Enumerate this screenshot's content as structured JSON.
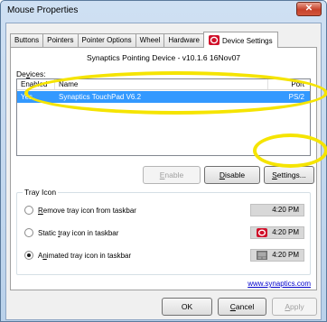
{
  "window": {
    "title": "Mouse Properties",
    "close_label": "✕"
  },
  "tabs": [
    "Buttons",
    "Pointers",
    "Pointer Options",
    "Wheel",
    "Hardware",
    "Device Settings"
  ],
  "driver": {
    "title": "Synaptics Pointing Device - v10.1.6 16Nov07"
  },
  "devices": {
    "label_prefix": "De",
    "label_underlined": "v",
    "label_suffix": "ices:",
    "columns": [
      "Enabled",
      "Name",
      "Port"
    ],
    "rows": [
      {
        "enabled": "Yes",
        "name": "Synaptics TouchPad V6.2",
        "port": "PS/2"
      }
    ]
  },
  "device_buttons": {
    "enable": {
      "u": "E",
      "rest": "nable"
    },
    "disable": {
      "u": "D",
      "rest": "isable"
    },
    "settings": {
      "u": "S",
      "rest": "ettings..."
    }
  },
  "tray": {
    "legend": "Tray Icon",
    "options": [
      {
        "u": "R",
        "rest": "emove tray icon from taskbar",
        "time": "4:20 PM",
        "icon": "none",
        "checked": false
      },
      {
        "pre": "Static ",
        "u": "t",
        "rest": "ray icon in taskbar",
        "time": "4:20 PM",
        "icon": "synaptics-red-icon",
        "checked": false
      },
      {
        "pre": "A",
        "u": "n",
        "rest": "imated tray icon in taskbar",
        "time": "4:20 PM",
        "icon": "touchpad-icon",
        "checked": true
      }
    ]
  },
  "link": {
    "text": "www.synaptics.com"
  },
  "dialog_buttons": {
    "ok": "OK",
    "cancel_u": "C",
    "cancel_rest": "ancel",
    "apply_u": "A",
    "apply_rest": "pply"
  },
  "colors": {
    "selection": "#3399ff",
    "highlight_ring": "#f5e400",
    "synaptics_red": "#d0102a"
  }
}
